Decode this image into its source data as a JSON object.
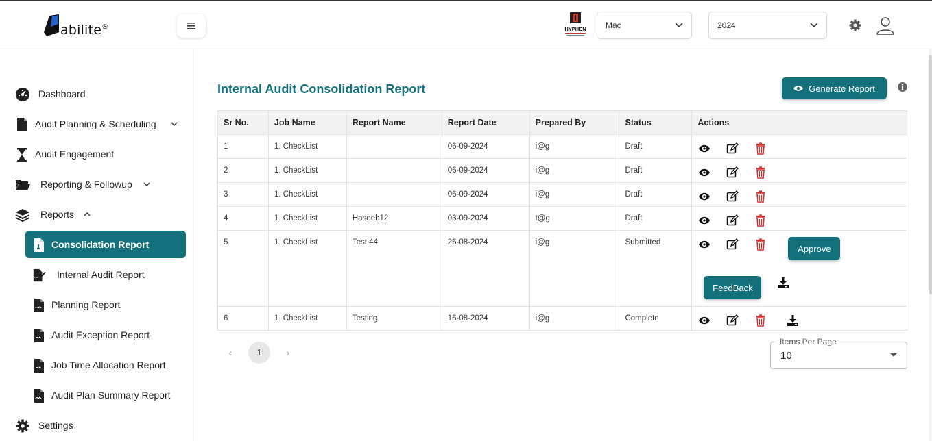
{
  "header": {
    "logo_text": "abilite",
    "logo_reg": "®",
    "menu_icon": "hamburger-icon",
    "company_logo_text": "HYPHEN",
    "org_select": "Mac",
    "year_select": "2024"
  },
  "sidebar": {
    "items": [
      {
        "label": "Dashboard",
        "icon": "dashboard-icon"
      },
      {
        "label": "Audit Planning & Scheduling",
        "icon": "file-icon",
        "chevron": "down"
      },
      {
        "label": "Audit Engagement",
        "icon": "hourglass-icon"
      },
      {
        "label": "Reporting & Followup",
        "icon": "folder-icon",
        "chevron": "down"
      },
      {
        "label": "Reports",
        "icon": "layers-icon",
        "chevron": "up"
      },
      {
        "label": "Settings",
        "icon": "gear-icon"
      }
    ],
    "reports_sub": [
      {
        "label": "Consolidation Report",
        "active": true
      },
      {
        "label": "Internal Audit Report"
      },
      {
        "label": "Planning Report"
      },
      {
        "label": "Audit Exception Report"
      },
      {
        "label": "Job Time Allocation Report"
      },
      {
        "label": "Audit Plan Summary Report"
      }
    ]
  },
  "main": {
    "title": "Internal Audit Consolidation Report",
    "generate_button": "Generate Report",
    "columns": [
      "Sr No.",
      "Job Name",
      "Report Name",
      "Report Date",
      "Prepared By",
      "Status",
      "Actions"
    ],
    "rows": [
      {
        "sr": "1",
        "job": "1. CheckList",
        "report": "",
        "date": "06-09-2024",
        "by": "i@g",
        "status": "Draft"
      },
      {
        "sr": "2",
        "job": "1. CheckList",
        "report": "",
        "date": "06-09-2024",
        "by": "i@g",
        "status": "Draft"
      },
      {
        "sr": "3",
        "job": "1. CheckList",
        "report": "",
        "date": "06-09-2024",
        "by": "i@g",
        "status": "Draft"
      },
      {
        "sr": "4",
        "job": "1. CheckList",
        "report": "Haseeb12",
        "date": "03-09-2024",
        "by": "t@g",
        "status": "Draft"
      },
      {
        "sr": "5",
        "job": "1. CheckList",
        "report": "Test 44",
        "date": "26-08-2024",
        "by": "i@g",
        "status": "Submitted",
        "approve": "Approve",
        "feedback": "FeedBack"
      },
      {
        "sr": "6",
        "job": "1. CheckList",
        "report": "Testing",
        "date": "16-08-2024",
        "by": "i@g",
        "status": "Complete"
      }
    ],
    "pagination": {
      "current": "1"
    },
    "items_per_page_label": "Items Per Page",
    "items_per_page": "10"
  },
  "colors": {
    "accent": "#14707a",
    "delete": "#d32f2f"
  }
}
